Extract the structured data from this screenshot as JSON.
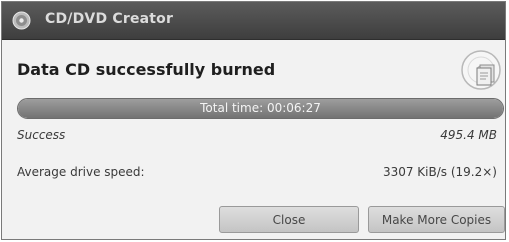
{
  "window": {
    "title": "CD/DVD Creator",
    "app_icon": "disc-burner-icon"
  },
  "dialog": {
    "heading": "Data CD successfully burned",
    "status_icon": "data-disc-icon"
  },
  "progress": {
    "text": "Total time: 00:06:27",
    "fraction": 1.0
  },
  "result": {
    "label": "Success",
    "size": "495.4 MB"
  },
  "speed": {
    "label": "Average drive speed:",
    "value": "3307 KiB/s (19.2×)"
  },
  "buttons": {
    "close": "Close",
    "more_copies": "Make More Copies"
  },
  "colors": {
    "titlebar": "#4a4a4a",
    "progress_fill": "#8a8a8a"
  }
}
